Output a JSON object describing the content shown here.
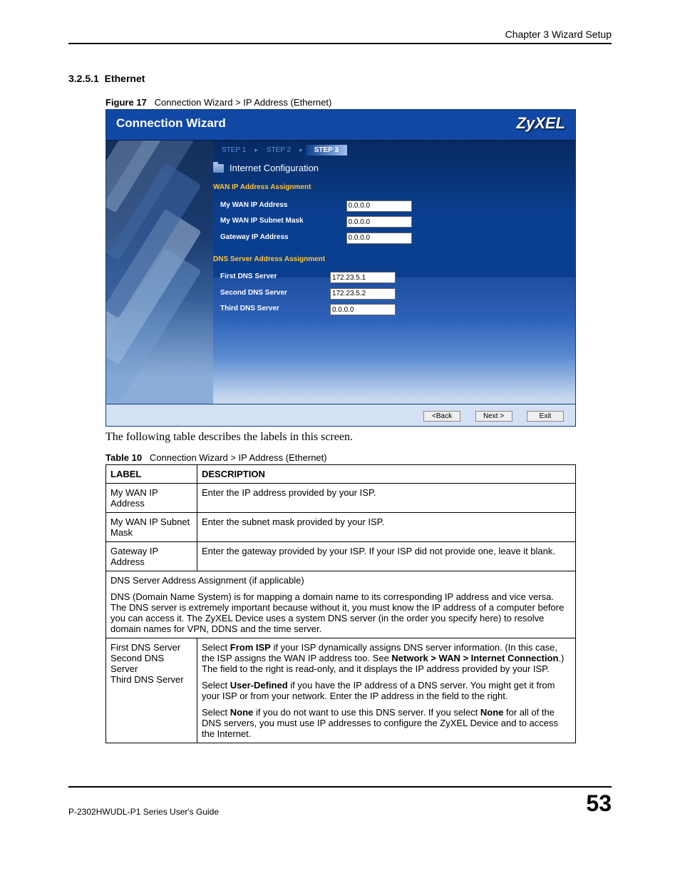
{
  "header": {
    "chapter": "Chapter 3 Wizard Setup"
  },
  "section": {
    "num": "3.2.5.1",
    "title": "Ethernet"
  },
  "figure": {
    "label": "Figure 17",
    "caption": "Connection Wizard > IP Address (Ethernet)"
  },
  "shot": {
    "title": "Connection Wizard",
    "brand": "ZyXEL",
    "steps": {
      "s1": "STEP 1",
      "s2": "STEP 2",
      "s3": "STEP 3"
    },
    "cfg_head": "Internet Configuration",
    "sec1": "WAN IP Address Assignment",
    "sec2": "DNS Server Address Assignment",
    "labels": {
      "wan_ip": "My WAN IP Address",
      "wan_mask": "My WAN IP Subnet Mask",
      "gateway": "Gateway IP Address",
      "dns1": "First DNS Server",
      "dns2": "Second DNS Server",
      "dns3": "Third DNS Server"
    },
    "values": {
      "wan_ip": "0.0.0.0",
      "wan_mask": "0.0.0.0",
      "gateway": "0.0.0.0",
      "dns1": "172.23.5.1",
      "dns2": "172.23.5.2",
      "dns3": "0.0.0.0"
    },
    "buttons": {
      "back": "<Back",
      "next": "Next >",
      "exit": "Exit"
    }
  },
  "intro": "The following table describes the labels in this screen.",
  "table": {
    "label": "Table 10",
    "caption": "Connection Wizard > IP Address (Ethernet)",
    "head": {
      "c1": "LABEL",
      "c2": "DESCRIPTION"
    },
    "rows": {
      "r1": {
        "label": "My WAN IP Address",
        "desc": "Enter the IP address provided by your ISP."
      },
      "r2": {
        "label": "My WAN IP Subnet Mask",
        "desc": "Enter the subnet mask provided by your ISP."
      },
      "r3": {
        "label": "Gateway IP Address",
        "desc": "Enter the gateway provided by your ISP. If your ISP did not provide one, leave it blank."
      },
      "r4": {
        "line1": "DNS Server Address Assignment (if applicable)",
        "line2": "DNS (Domain Name System) is for mapping a domain name to its corresponding IP address and vice versa. The DNS server is extremely important because without it, you must know the IP address of a computer before you can access it. The ZyXEL Device uses a system DNS server (in the order you specify here) to resolve domain names for VPN, DDNS and the time server."
      },
      "r5": {
        "label_l1": "First DNS Server",
        "label_l2": "Second DNS Server",
        "label_l3": "Third DNS Server",
        "d_p1a": "Select ",
        "d_p1b": "From ISP",
        "d_p1c": " if your ISP dynamically assigns DNS server information. (In this case, the ISP assigns the WAN IP address too. See ",
        "d_p1d": "Network > WAN > Internet Connection",
        "d_p1e": ".) The field to the right is read-only, and it displays the IP address provided by your ISP.",
        "d_p2a": "Select ",
        "d_p2b": "User-Defined",
        "d_p2c": " if you have the IP address of a DNS server. You might get it from your ISP or from your network. Enter the IP address in the field to the right.",
        "d_p3a": "Select ",
        "d_p3b": "None",
        "d_p3c": " if you do not want to use this DNS server. If you select ",
        "d_p3d": "None",
        "d_p3e": " for all of the DNS servers, you must use IP addresses to configure the ZyXEL Device and to access the Internet."
      }
    }
  },
  "footer": {
    "guide": "P-2302HWUDL-P1 Series User's Guide",
    "page": "53"
  }
}
